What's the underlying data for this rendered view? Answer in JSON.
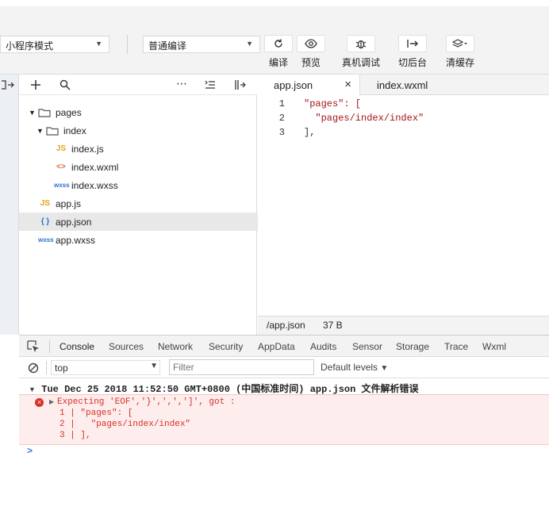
{
  "toolbar": {
    "mode_select": "小程序模式",
    "compile_select": "普通编译",
    "buttons": [
      {
        "label": "编译",
        "icon": "refresh-icon"
      },
      {
        "label": "预览",
        "icon": "eye-icon"
      },
      {
        "label": "真机调试",
        "icon": "bug-icon"
      },
      {
        "label": "切后台",
        "icon": "background-switch-icon"
      },
      {
        "label": "清缓存",
        "icon": "layers-icon"
      }
    ]
  },
  "file_tree": {
    "items": [
      {
        "name": "pages",
        "type": "folder"
      },
      {
        "name": "index",
        "type": "folder"
      },
      {
        "name": "index.js",
        "type": "js"
      },
      {
        "name": "index.wxml",
        "type": "wxml"
      },
      {
        "name": "index.wxss",
        "type": "wxss"
      },
      {
        "name": "app.js",
        "type": "js"
      },
      {
        "name": "app.json",
        "type": "json"
      },
      {
        "name": "app.wxss",
        "type": "wxss"
      }
    ],
    "icon_labels": {
      "js": "JS",
      "wxml": "<>",
      "wxss": "wxss",
      "json": "{ }"
    }
  },
  "editor": {
    "tabs": [
      {
        "label": "app.json"
      },
      {
        "label": "index.wxml"
      }
    ],
    "lines": [
      {
        "n": "1",
        "text": "\"pages\": ["
      },
      {
        "n": "2",
        "text": "  \"pages/index/index\""
      },
      {
        "n": "3",
        "text": "],"
      }
    ],
    "status_path": "/app.json",
    "status_size": "37 B"
  },
  "devtools": {
    "tabs": [
      "Console",
      "Sources",
      "Network",
      "Security",
      "AppData",
      "Audits",
      "Sensor",
      "Storage",
      "Trace",
      "Wxml"
    ],
    "context": "top",
    "filter_placeholder": "Filter",
    "levels": "Default levels",
    "group_header": "Tue Dec 25 2018 11:52:50 GMT+0800 (中国标准时间) app.json 文件解析错误",
    "error_message": "Expecting 'EOF','}',',',']', got :",
    "error_lines": [
      "1 | \"pages\": [",
      "2 |   \"pages/index/index\"",
      "3 | ],"
    ],
    "prompt": ">"
  },
  "colors": {
    "accent": "#3879d9",
    "error": "#d93025",
    "string": "#a31515",
    "js_icon": "#e3a21a",
    "folder": "#555555"
  }
}
